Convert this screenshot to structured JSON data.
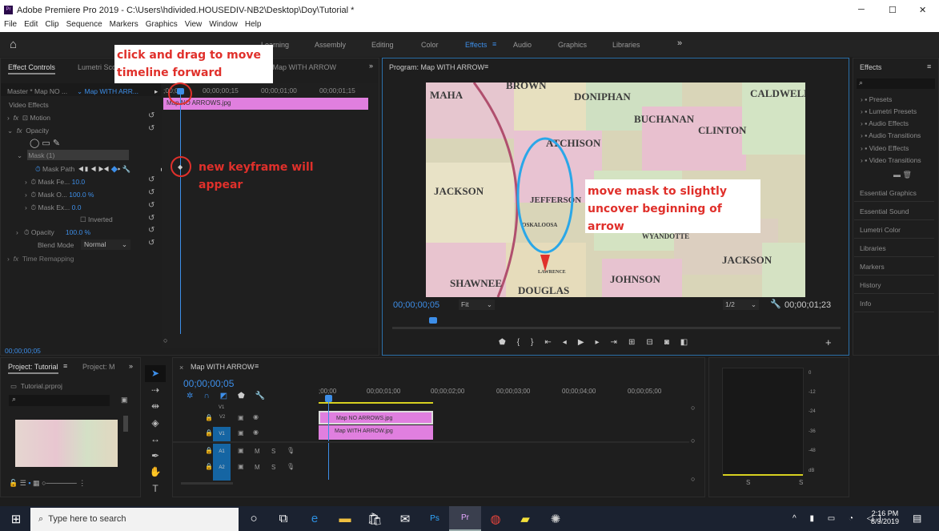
{
  "window": {
    "title": "Adobe Premiere Pro 2019 - C:\\Users\\hdivided.HOUSEDIV-NB2\\Desktop\\Doy\\Tutorial *",
    "controls": [
      "─",
      "☐",
      "✕"
    ]
  },
  "menu": [
    "File",
    "Edit",
    "Clip",
    "Sequence",
    "Markers",
    "Graphics",
    "View",
    "Window",
    "Help"
  ],
  "workspaces": [
    "Learning",
    "Assembly",
    "Editing",
    "Color",
    "Effects",
    "Audio",
    "Graphics",
    "Libraries"
  ],
  "active_workspace": "Effects",
  "effect_controls": {
    "tabs": [
      "Effect Controls",
      "Lumetri Scopes",
      "Program: Map WITH ARROW"
    ],
    "source": "Master * Map NO ...",
    "clip": "Map WITH ARR...",
    "ruler": [
      ";00;00",
      "00;00;00;15",
      "00;00;01;00",
      "00;00;01;15"
    ],
    "clip_bar": "Map NO ARROWS.jpg",
    "section": "Video Effects",
    "motion": "Motion",
    "opacity": "Opacity",
    "mask": "Mask (1)",
    "mask_path": "Mask Path",
    "mask_feather": {
      "label": "Mask Fe...",
      "value": "10.0"
    },
    "mask_opacity": {
      "label": "Mask O...",
      "value": "100.0 %"
    },
    "mask_expansion": {
      "label": "Mask Ex...",
      "value": "0.0"
    },
    "inverted": "Inverted",
    "opacity_value": {
      "label": "Opacity",
      "value": "100.0 %"
    },
    "blend_mode": {
      "label": "Blend Mode",
      "value": "Normal"
    },
    "time_remapping": "Time Remapping",
    "timecode": "00;00;00;05"
  },
  "program": {
    "title": "Program: Map WITH ARROW",
    "timecode": "00;00;00;05",
    "fit": "Fit",
    "resolution": "1/2",
    "duration": "00;00;01;23",
    "map_labels": [
      "MAHA",
      "BROWN",
      "DONIPHAN",
      "BUCHANAN",
      "CLINTON",
      "CALDWELL",
      "ATCHISON",
      "JACKSON",
      "JEFFERSON",
      "OSKALOOSA",
      "WYANDOTTE",
      "JACKSON",
      "SHAWNEE",
      "JOHNSON",
      "DOUGLAS",
      "LAWRENCE"
    ]
  },
  "effects_panel": {
    "title": "Effects",
    "items": [
      "Presets",
      "Lumetri Presets",
      "Audio Effects",
      "Audio Transitions",
      "Video Effects",
      "Video Transitions"
    ]
  },
  "side_panels": [
    "Essential Graphics",
    "Essential Sound",
    "Lumetri Color",
    "Libraries",
    "Markers",
    "History",
    "Info"
  ],
  "project": {
    "tabs": [
      "Project: Tutorial",
      "Project: M"
    ],
    "file": "Tutorial.prproj"
  },
  "timeline": {
    "title": "Map WITH ARROW",
    "timecode": "00;00;00;05",
    "ruler": [
      ";00;00",
      "00;00;01;00",
      "00;00;02;00",
      "00;00;03;00",
      "00;00;04;00",
      "00;00;05;00"
    ],
    "tracks": [
      "V1",
      "V2",
      "V1",
      "A1",
      "A2"
    ],
    "track_buttons": [
      "M",
      "S"
    ],
    "clips": [
      "Map NO ARROWS.jpg",
      "Map WITH ARROW.jpg"
    ]
  },
  "audio_meter": {
    "scale": [
      "0",
      "-12",
      "-24",
      "-36",
      "-48",
      "dB"
    ],
    "solo": [
      "S",
      "S"
    ]
  },
  "annotations": {
    "drag": "click and drag to move timeline forward",
    "keyframe": "new keyframe will appear",
    "mask": "move mask to slightly uncover beginning of arrow"
  },
  "taskbar": {
    "search": "Type here to search",
    "time": "2:16 PM",
    "date": "8/9/2019"
  },
  "colors": {
    "accent": "#3d8ee8",
    "clip": "#e07fdf",
    "annotation": "#e0302b",
    "mask_outline": "#2aa7e8"
  }
}
